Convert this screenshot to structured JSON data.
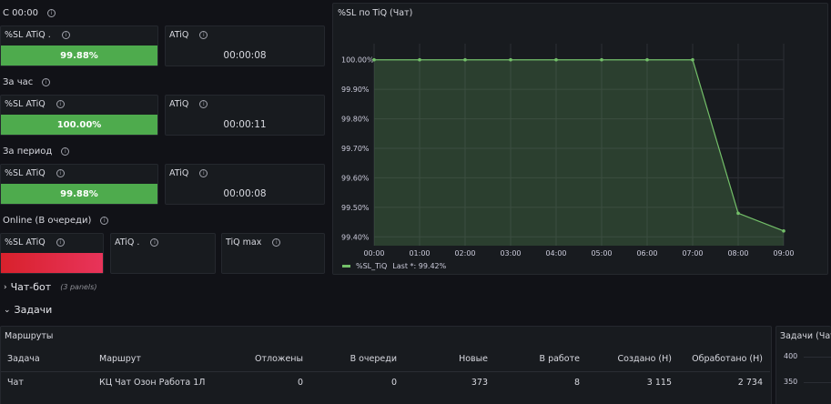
{
  "sections": {
    "since_midnight": "С 00:00",
    "per_hour": "За час",
    "per_period": "За период",
    "online": "Online (В очереди)"
  },
  "stats": {
    "row1": {
      "sl_title": "%SL ATiQ .",
      "sl_value": "99.88%",
      "sl_fraction": 0.9988,
      "atiq_title": "ATiQ",
      "atiq_value": "00:00:08"
    },
    "row2": {
      "sl_title": "%SL ATiQ",
      "sl_value": "100.00%",
      "sl_fraction": 1.0,
      "atiq_title": "ATiQ",
      "atiq_value": "00:00:11"
    },
    "row3": {
      "sl_title": "%SL ATiQ",
      "sl_value": "99.88%",
      "sl_fraction": 0.9988,
      "atiq_title": "ATiQ",
      "atiq_value": "00:00:08"
    },
    "row4": {
      "sl_title": "%SL ATiQ",
      "atiq_title": "ATiQ .",
      "tiq_title": "TiQ max"
    }
  },
  "chart_panel": {
    "title": "%SL по TiQ (Чат)"
  },
  "chart_data": {
    "type": "area",
    "x": [
      "00:00",
      "01:00",
      "02:00",
      "03:00",
      "04:00",
      "05:00",
      "06:00",
      "07:00",
      "08:00",
      "09:00"
    ],
    "series": [
      {
        "name": "%SL_TiQ",
        "values": [
          100.0,
          100.0,
          100.0,
          100.0,
          100.0,
          100.0,
          100.0,
          100.0,
          99.48,
          99.42
        ]
      }
    ],
    "yticks": [
      "100.00%",
      "99.90%",
      "99.80%",
      "99.70%",
      "99.60%",
      "99.50%",
      "99.40%"
    ],
    "ylim": [
      99.37,
      100.03
    ],
    "legend_text": "%SL_TiQ",
    "legend_last": "Last *: 99.42%",
    "color": "#73bf69"
  },
  "rows": {
    "chatbot": {
      "label": "Чат-бот",
      "sub": "(3 panels)"
    },
    "tasks": {
      "label": "Задачи"
    }
  },
  "routes": {
    "title": "Маршруты",
    "columns": [
      "Задача",
      "Маршрут",
      "Отложены",
      "В очереди",
      "Новые",
      "В работе",
      "Создано (Н)",
      "Обработано (Н)"
    ],
    "rows": [
      [
        "Чат",
        "КЦ Чат Озон Работа 1Л",
        "0",
        "0",
        "373",
        "8",
        "3 115",
        "2 734"
      ]
    ]
  },
  "tasks_panel": {
    "title": "Задачи (Чат",
    "yticks": [
      "400",
      "350"
    ]
  },
  "icons": {
    "info": "info-icon",
    "collapse": "chevron-right-icon",
    "expand": "chevron-down-icon"
  }
}
